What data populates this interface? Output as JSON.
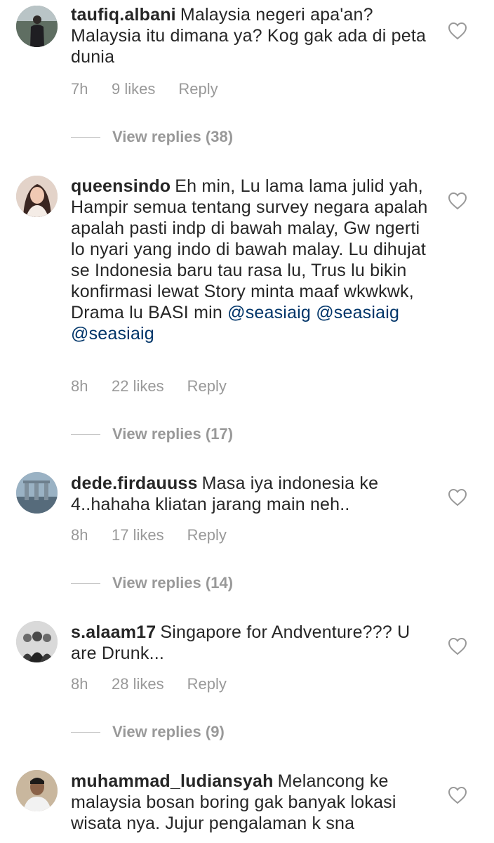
{
  "comments": [
    {
      "username": "taufiq.albani",
      "text": "Malaysia negeri apa'an? Malaysia itu dimana ya? Kog gak ada di peta dunia",
      "time": "7h",
      "likes": "9 likes",
      "reply": "Reply",
      "view_replies": "View replies (38)",
      "avatar_icon": "man-standing-photo-icon"
    },
    {
      "username": "queensindo",
      "text": "Eh min, Lu lama lama julid yah, Hampir semua tentang survey negara apalah apalah pasti indp di bawah malay, Gw ngerti lo nyari yang indo di bawah malay. Lu dihujat se Indonesia baru tau rasa lu, Trus lu bikin konfirmasi lewat Story minta maaf wkwkwk, Drama lu BASI min",
      "mentions": [
        "@seasiaig",
        "@seasiaig",
        "@seasiaig"
      ],
      "time": "8h",
      "likes": "22 likes",
      "reply": "Reply",
      "view_replies": "View replies (17)",
      "avatar_icon": "woman-portrait-icon"
    },
    {
      "username": "dede.firdauuss",
      "text": "Masa iya indonesia ke 4..hahaha kliatan jarang main neh..",
      "time": "8h",
      "likes": "17 likes",
      "reply": "Reply",
      "view_replies": "View replies (14)",
      "avatar_icon": "city-skyline-icon"
    },
    {
      "username": "s.alaam17",
      "text": "Singapore for Andventure??? U are Drunk...",
      "time": "8h",
      "likes": "28 likes",
      "reply": "Reply",
      "view_replies": "View replies (9)",
      "avatar_icon": "group-photo-icon"
    },
    {
      "username": "muhammad_ludiansyah",
      "text": "Melancong ke malaysia bosan boring gak banyak lokasi wisata nya. Jujur pengalaman k sna",
      "avatar_icon": "man-portrait-icon"
    }
  ],
  "colors": {
    "text": "#262626",
    "meta": "#999999",
    "mention": "#003569",
    "heart_outline": "#999999"
  },
  "icons": {
    "like": "heart-outline-icon"
  }
}
